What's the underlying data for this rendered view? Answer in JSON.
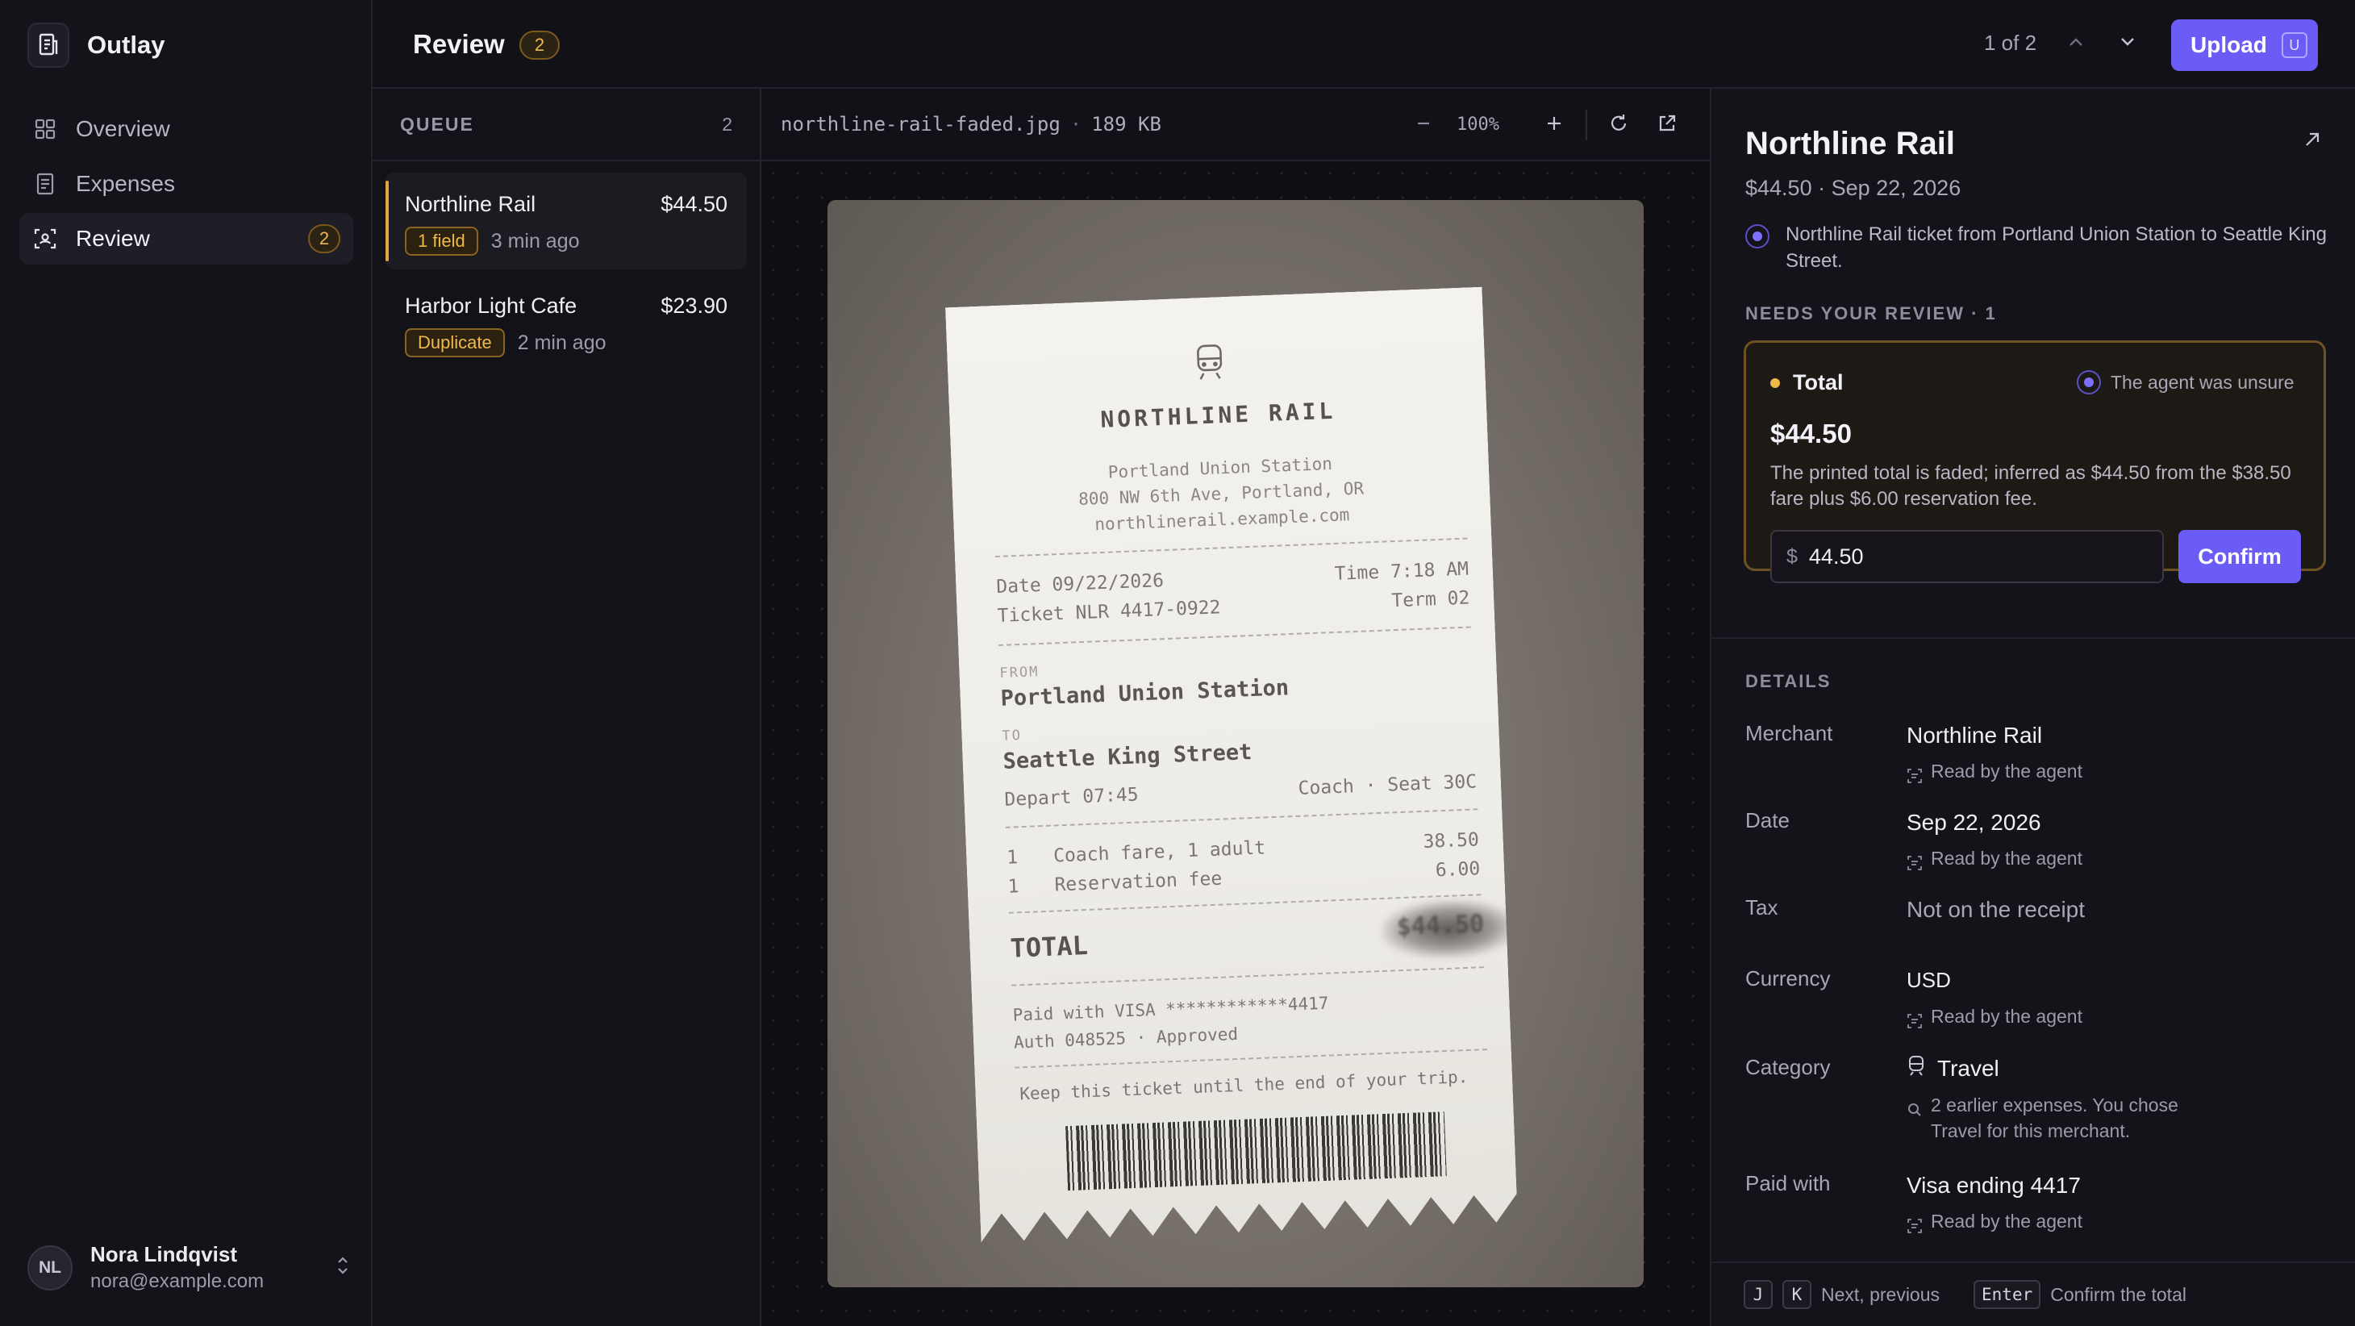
{
  "app": {
    "name": "Outlay"
  },
  "sidebar": {
    "items": [
      {
        "label": "Overview",
        "icon": "grid-icon"
      },
      {
        "label": "Expenses",
        "icon": "receipt-icon"
      },
      {
        "label": "Review",
        "icon": "scan-icon",
        "count": "2"
      }
    ],
    "user": {
      "initials": "NL",
      "name": "Nora Lindqvist",
      "email": "nora@example.com"
    }
  },
  "header": {
    "title": "Review",
    "count": "2",
    "pager": "1 of 2",
    "upload_label": "Upload",
    "upload_shortcut": "U"
  },
  "queue": {
    "heading": "QUEUE",
    "count": "2",
    "items": [
      {
        "merchant": "Northline Rail",
        "amount": "$44.50",
        "tag": "1 field",
        "time": "3 min ago"
      },
      {
        "merchant": "Harbor Light Cafe",
        "amount": "$23.90",
        "tag": "Duplicate",
        "time": "2 min ago"
      }
    ]
  },
  "viewer": {
    "file_name": "northline-rail-faded.jpg",
    "separator": "·",
    "file_size": "189 KB",
    "zoom": "100%"
  },
  "receipt": {
    "brand": "NORTHLINE RAIL",
    "address": [
      "Portland Union Station",
      "800 NW 6th Ave, Portland, OR",
      "northlinerail.example.com"
    ],
    "date": "Date 09/22/2026",
    "time": "Time 7:18 AM",
    "ticket": "Ticket NLR 4417-0922",
    "term": "Term 02",
    "from_label": "FROM",
    "from": "Portland Union Station",
    "to_label": "TO",
    "to": "Seattle King Street",
    "depart": "Depart 07:45",
    "class_seat": "Coach · Seat 30C",
    "line1_qty": "1",
    "line1_desc": "Coach fare, 1 adult",
    "line1_amt": "38.50",
    "line2_qty": "1",
    "line2_desc": "Reservation fee",
    "line2_amt": "6.00",
    "total_label": "TOTAL",
    "total_faded": "$44.50",
    "paid": "Paid with VISA ************4417",
    "auth": "Auth 048525 · Approved",
    "footer": "Keep this ticket until the end of your trip."
  },
  "detail": {
    "merchant": "Northline Rail",
    "subtitle": "$44.50 · Sep 22, 2026",
    "description": "Northline Rail ticket from Portland Union Station to Seattle King Street.",
    "review_heading": "NEEDS YOUR REVIEW · 1",
    "review": {
      "field": "Total",
      "unsure": "The agent was unsure",
      "value": "$44.50",
      "note": "The printed total is faded; inferred as $44.50 from the $38.50 fare plus $6.00 reservation fee.",
      "currency_symbol": "$",
      "input_value": "44.50",
      "confirm_label": "Confirm"
    },
    "details_heading": "DETAILS",
    "rows": {
      "merchant": {
        "label": "Merchant",
        "value": "Northline Rail",
        "meta": "Read by the agent"
      },
      "date": {
        "label": "Date",
        "value": "Sep 22, 2026",
        "meta": "Read by the agent"
      },
      "tax": {
        "label": "Tax",
        "value": "Not on the receipt"
      },
      "currency": {
        "label": "Currency",
        "value": "USD",
        "meta": "Read by the agent"
      },
      "category": {
        "label": "Category",
        "value": "Travel",
        "meta": "2 earlier expenses. You chose Travel for this merchant."
      },
      "paid_with": {
        "label": "Paid with",
        "value": "Visa ending 4417",
        "meta": "Read by the agent"
      }
    },
    "footer": {
      "key_j": "J",
      "key_k": "K",
      "nav_hint": "Next, previous",
      "key_enter": "Enter",
      "confirm_hint": "Confirm the total"
    }
  },
  "colors": {
    "accent": "#6a5cf4",
    "warning": "#f0b94a",
    "background": "#121118"
  }
}
